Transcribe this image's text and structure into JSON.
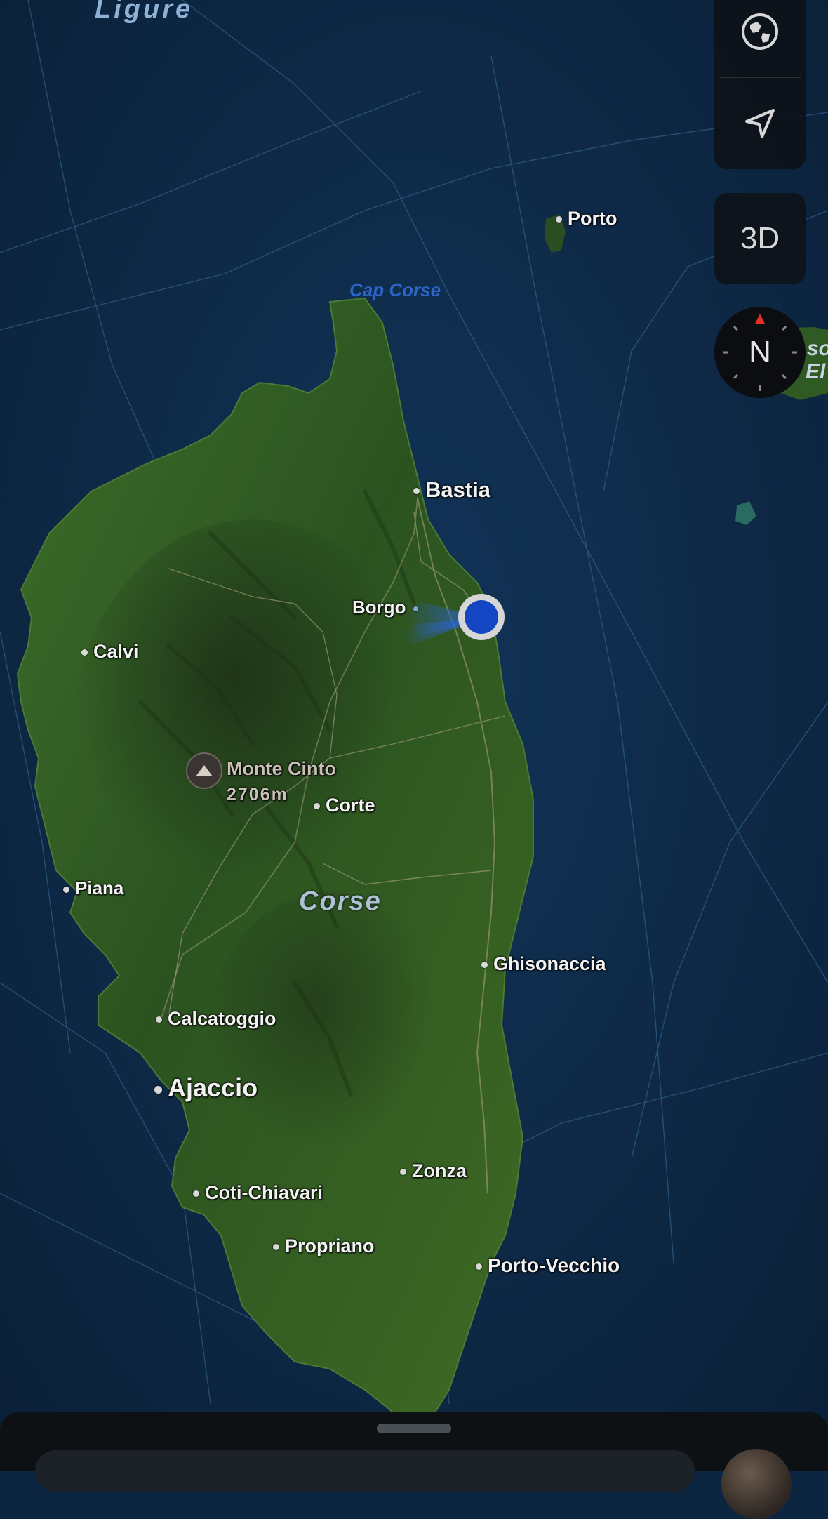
{
  "water_labels": {
    "ligure": "Ligure",
    "cap_corse": "Cap Corse",
    "corse": "Corse",
    "right_edge_top": "so",
    "right_edge_bottom": "El"
  },
  "places": {
    "porto": "Porto",
    "bastia": "Bastia",
    "borgo": "Borgo",
    "calvi": "Calvi",
    "corte": "Corte",
    "piana": "Piana",
    "ghisonaccia": "Ghisonaccia",
    "calcatoggio": "Calcatoggio",
    "ajaccio": "Ajaccio",
    "zonza": "Zonza",
    "coti_chiavari": "Coti-Chiavari",
    "propriano": "Propriano",
    "porto_vecchio": "Porto-Vecchio"
  },
  "peak": {
    "name": "Monte Cinto",
    "elevation": "2706m"
  },
  "controls": {
    "map_mode_icon": "globe-icon",
    "location_icon": "location-arrow-icon",
    "three_d_label": "3D",
    "compass_label": "N"
  },
  "colors": {
    "ocean": "#0c2540",
    "land": "#2f5a24",
    "user_location": "#1446c4",
    "water_label": "#2c64c8"
  }
}
